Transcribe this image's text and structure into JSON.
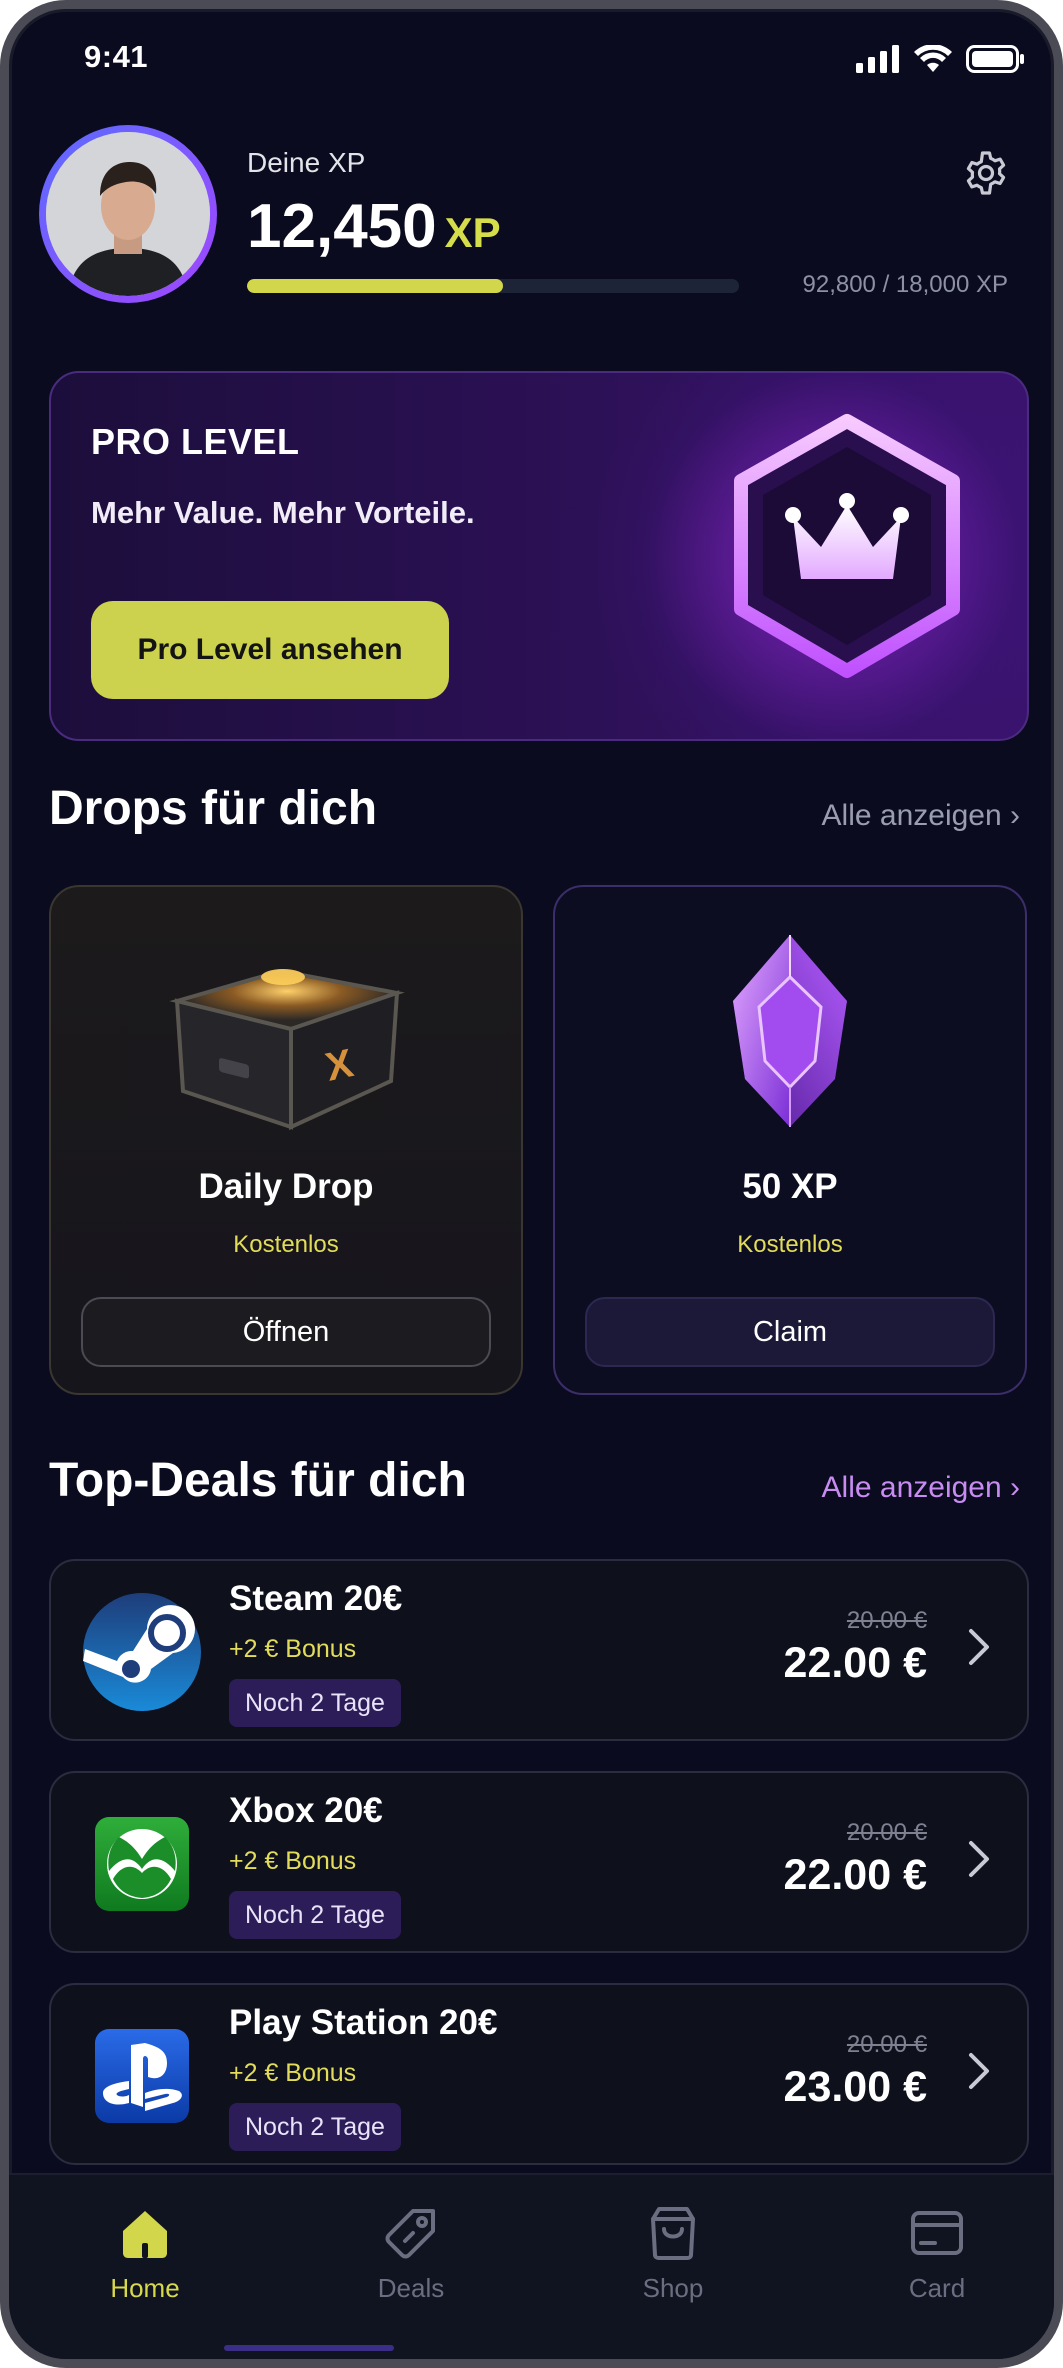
{
  "status_bar": {
    "time": "9:41"
  },
  "header": {
    "xp_label": "Deine XP",
    "xp_value": "12,450",
    "xp_unit": "XP",
    "xp_progress_text": "92,800 / 18,000 XP",
    "xp_bar_fraction": 0.52
  },
  "pro_card": {
    "title": "PRO LEVEL",
    "subtitle": "Mehr Value. Mehr Vorteile.",
    "button_label": "Pro Level ansehen"
  },
  "drops": {
    "title": "Drops für dich",
    "link": "Alle anzeigen ›",
    "items": [
      {
        "title": "Daily Drop",
        "subtitle": "Kostenlos",
        "button": "Öffnen",
        "icon": "crate-icon"
      },
      {
        "title": "50 XP",
        "subtitle": "Kostenlos",
        "button": "Claim",
        "icon": "gem-icon"
      }
    ]
  },
  "deals": {
    "title": "Top-Deals für dich",
    "link": "Alle anzeigen ›",
    "items": [
      {
        "name": "Steam 20€",
        "bonus": "+2 € Bonus",
        "tag": "Noch 2 Tage",
        "old_price": "20.00 €",
        "price": "22.00 €",
        "icon": "steam-icon"
      },
      {
        "name": "Xbox 20€",
        "bonus": "+2 € Bonus",
        "tag": "Noch 2 Tage",
        "old_price": "20.00 €",
        "price": "22.00 €",
        "icon": "xbox-icon"
      },
      {
        "name": "Play Station 20€",
        "bonus": "+2 € Bonus",
        "tag": "Noch 2 Tage",
        "old_price": "20.00 €",
        "price": "23.00 €",
        "icon": "playstation-icon"
      }
    ]
  },
  "bottom_nav": {
    "items": [
      {
        "label": "Home",
        "icon": "home-icon",
        "active": true
      },
      {
        "label": "Deals",
        "icon": "tag-icon",
        "active": false
      },
      {
        "label": "Shop",
        "icon": "shopping-bag-icon",
        "active": false
      },
      {
        "label": "Card",
        "icon": "card-icon",
        "active": false
      }
    ]
  },
  "colors": {
    "background": "#0a0b1e",
    "accent_yellow": "#ccd24e",
    "accent_purple": "#c88bf2",
    "tag_bg": "#2c1d58"
  }
}
